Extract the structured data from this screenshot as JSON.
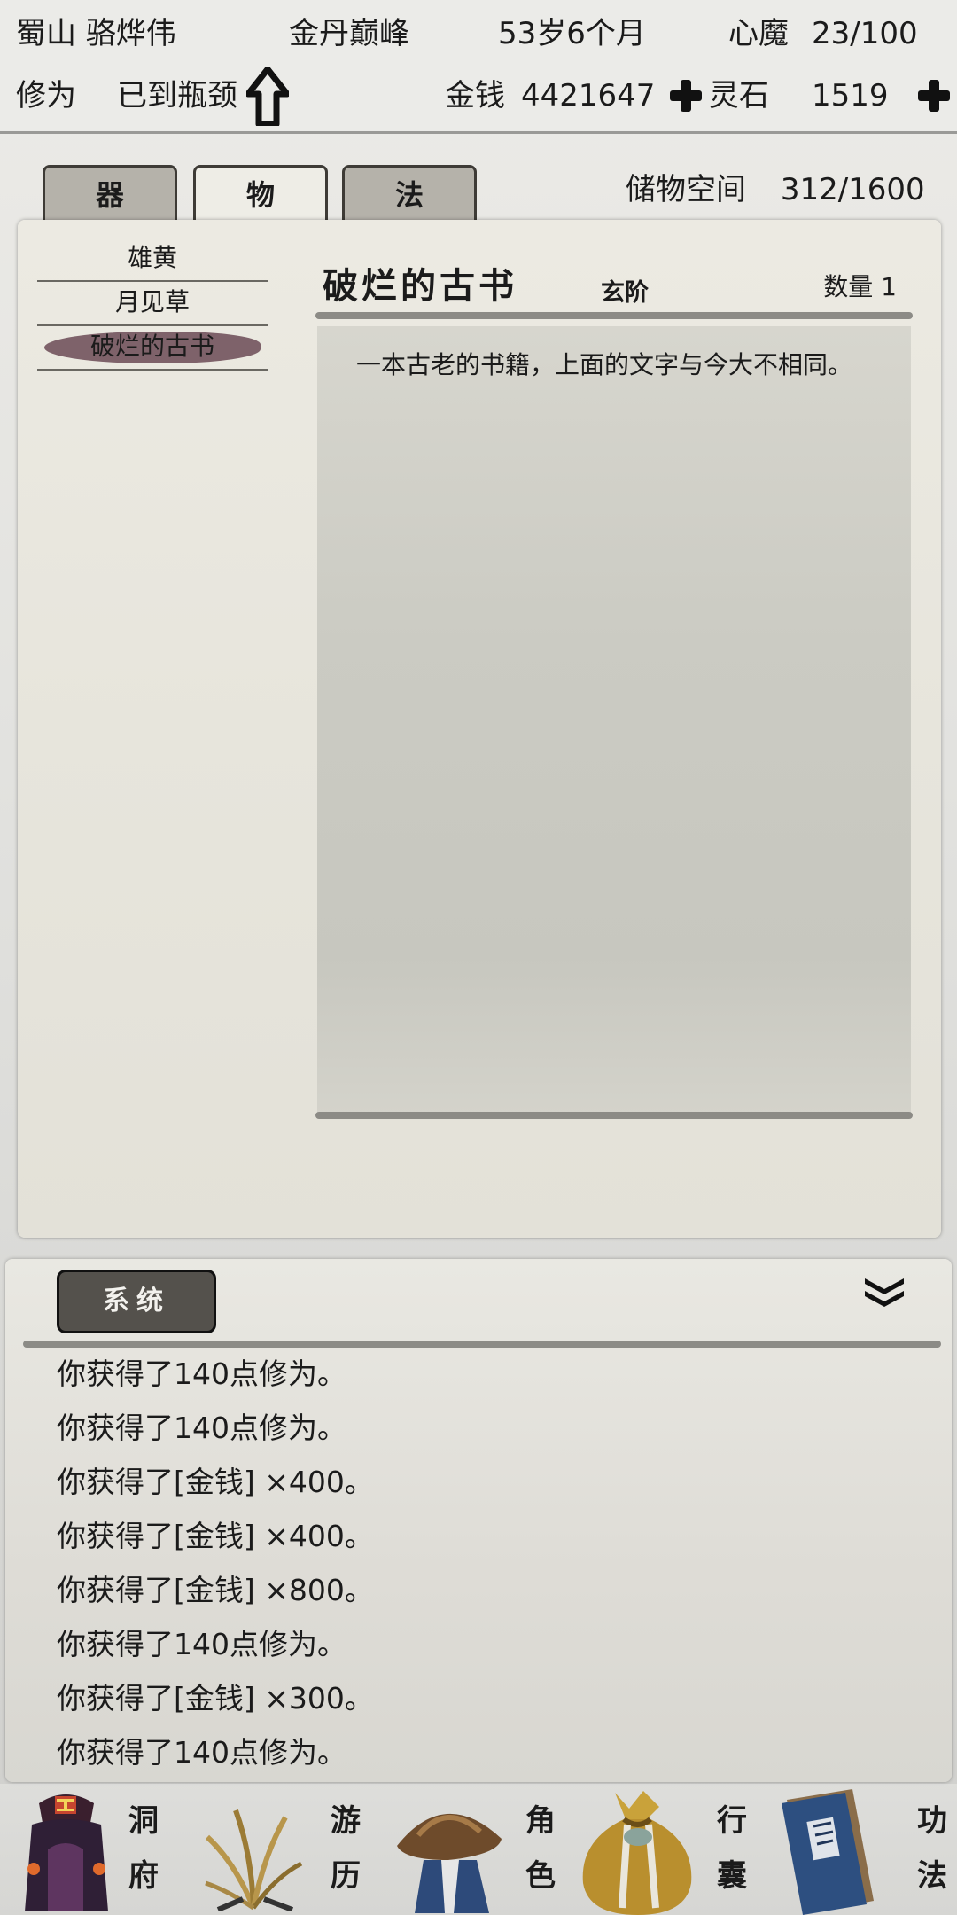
{
  "status": {
    "sect_name": "蜀山 骆烨伟",
    "realm": "金丹巅峰",
    "age": "53岁6个月",
    "heart_demon_label": "心魔",
    "heart_demon_value": "23/100",
    "cultivation_label": "修为",
    "cultivation_status": "已到瓶颈",
    "money_label": "金钱",
    "money_value": "4421647",
    "spirit_stone_label": "灵石",
    "spirit_stone_value": "1519"
  },
  "tabs": [
    {
      "label": "器"
    },
    {
      "label": "物"
    },
    {
      "label": "法"
    }
  ],
  "active_tab": "物",
  "storage": {
    "label": "储物空间",
    "value": "312/1600"
  },
  "item_list": [
    {
      "name": "雄黄"
    },
    {
      "name": "月见草"
    },
    {
      "name": "破烂的古书"
    }
  ],
  "selected_item": "破烂的古书",
  "detail": {
    "title": "破烂的古书",
    "grade": "玄阶",
    "quantity": "数量 1",
    "description": "一本古老的书籍，上面的文字与今大不相同。"
  },
  "log": {
    "tab_label": "系统",
    "lines": [
      "你获得了140点修为。",
      "你获得了140点修为。",
      "你获得了[金钱] ×400。",
      "你获得了[金钱] ×400。",
      "你获得了[金钱] ×800。",
      "你获得了140点修为。",
      "你获得了[金钱] ×300。",
      "你获得了140点修为。"
    ]
  },
  "bottom_nav": [
    {
      "top": "洞",
      "bottom": "府",
      "icon": "cave-dwelling-icon"
    },
    {
      "top": "游",
      "bottom": "历",
      "icon": "travel-grass-icon"
    },
    {
      "top": "角",
      "bottom": "色",
      "icon": "character-hat-icon"
    },
    {
      "top": "行",
      "bottom": "囊",
      "icon": "bag-icon"
    },
    {
      "top": "功",
      "bottom": "法",
      "icon": "technique-book-icon"
    }
  ],
  "colors": {
    "selected_item_highlight": "#6b4a55",
    "system_tab_bg": "#54514c",
    "divider": "#8c8b86"
  }
}
